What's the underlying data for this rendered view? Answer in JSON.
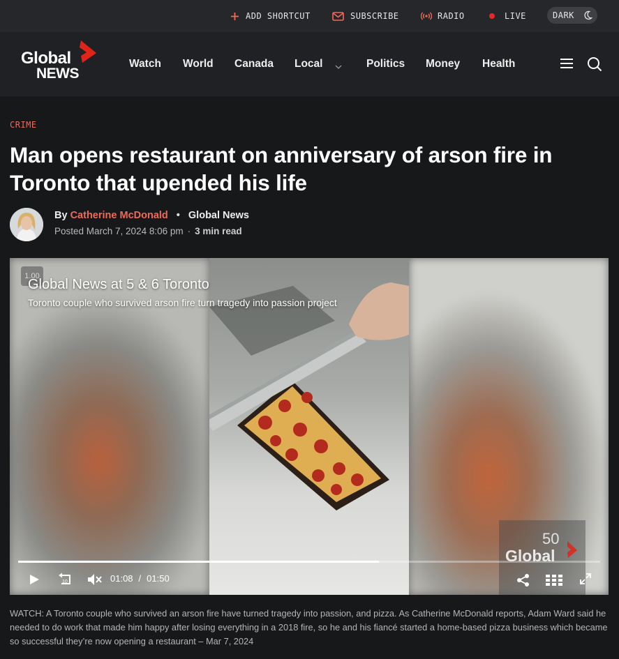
{
  "utility": {
    "add_shortcut": "ADD SHORTCUT",
    "subscribe": "SUBSCRIBE",
    "radio": "RADIO",
    "live": "LIVE",
    "dark": "DARK"
  },
  "logo": {
    "line1": "Global",
    "line2": "NEWS"
  },
  "nav": {
    "items": [
      "Watch",
      "World",
      "Canada",
      "Local",
      "Politics",
      "Money",
      "Health"
    ]
  },
  "article": {
    "category": "CRIME",
    "headline": "Man opens restaurant on anniversary of arson fire in Toronto that upended his life",
    "by": "By",
    "author": "Catherine McDonald",
    "outlet": "Global News",
    "posted": "Posted March 7, 2024 8:06 pm",
    "read_time": "3 min read"
  },
  "video": {
    "speed": "1.00",
    "title": "Global News at 5 & 6 Toronto",
    "subtitle": "Toronto couple who survived arson fire turn tragedy into passion project",
    "current_time": "01:08",
    "divider": "/",
    "duration": "01:50",
    "progress_fraction": 0.62,
    "bug_number": "50",
    "bug_text": "Global"
  },
  "caption": "WATCH: A Toronto couple who survived an arson fire have turned tragedy into passion, and pizza. As Catherine McDonald reports, Adam Ward said he needed to do work that made him happy after losing everything in a 2018 fire, so he and his fiancé started a home-based pizza business which became so successful they’re now opening a restaurant – Mar 7, 2024",
  "colors": {
    "accent": "#f06a5b",
    "live": "#e8272a",
    "brand_red": "#e2231a"
  }
}
